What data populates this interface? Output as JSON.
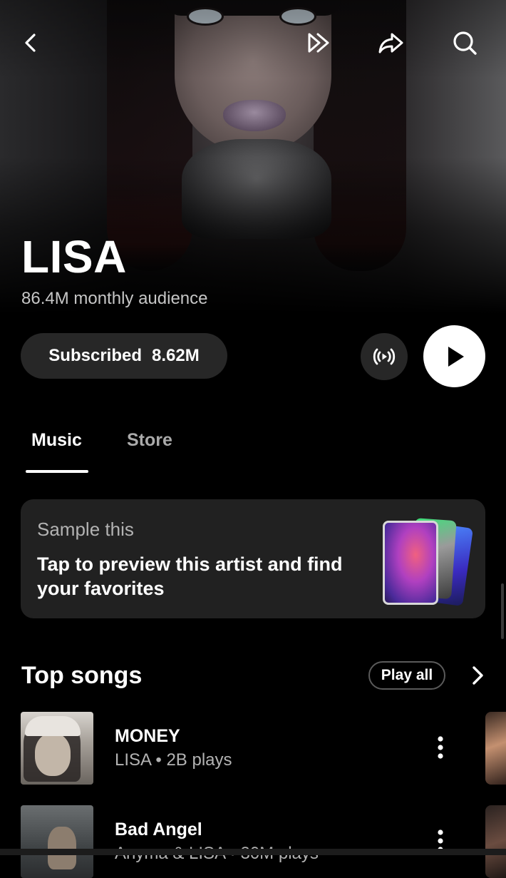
{
  "artist": {
    "name": "LISA",
    "audience": "86.4M monthly audience"
  },
  "actions": {
    "subscribed_label": "Subscribed",
    "subscriber_count": "8.62M"
  },
  "tabs": [
    {
      "label": "Music",
      "selected": true
    },
    {
      "label": "Store",
      "selected": false
    }
  ],
  "sample_card": {
    "title": "Sample this",
    "description": "Tap to preview this artist and find your favorites"
  },
  "top_songs": {
    "title": "Top songs",
    "play_all_label": "Play all",
    "songs": [
      {
        "title": "MONEY",
        "subtitle": "LISA • 2B plays"
      },
      {
        "title": "Bad Angel",
        "subtitle": "Anyma & LISA • 30M plays"
      }
    ]
  },
  "icons": {
    "back": "chevron-left-icon",
    "fast_forward": "double-chevron-icon",
    "share": "share-arrow-icon",
    "search": "search-icon",
    "radio": "radio-broadcast-icon",
    "play": "play-icon",
    "more": "vertical-ellipsis-icon"
  },
  "colors": {
    "background": "#000000",
    "surface": "#212121",
    "button": "#272727",
    "text_secondary": "#b3b3b3"
  }
}
